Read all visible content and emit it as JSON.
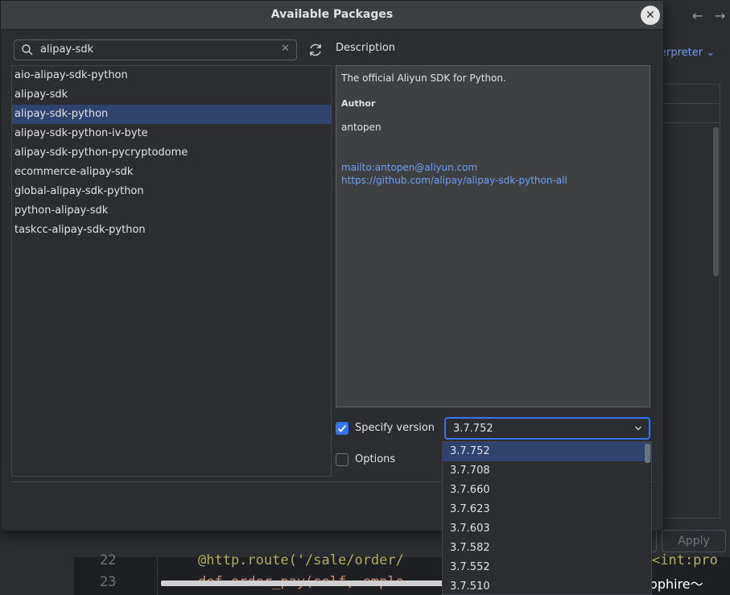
{
  "dialog": {
    "title": "Available Packages",
    "close_glyph": "✕"
  },
  "search": {
    "value": "alipay-sdk",
    "clear_glyph": "✕"
  },
  "packages": [
    {
      "label": "aio-alipay-sdk-python",
      "selected": false
    },
    {
      "label": "alipay-sdk",
      "selected": false
    },
    {
      "label": "alipay-sdk-python",
      "selected": true
    },
    {
      "label": "alipay-sdk-python-iv-byte",
      "selected": false
    },
    {
      "label": "alipay-sdk-python-pycryptodome",
      "selected": false
    },
    {
      "label": "ecommerce-alipay-sdk",
      "selected": false
    },
    {
      "label": "global-alipay-sdk-python",
      "selected": false
    },
    {
      "label": "python-alipay-sdk",
      "selected": false
    },
    {
      "label": "taskcc-alipay-sdk-python",
      "selected": false
    }
  ],
  "description": {
    "label": "Description",
    "summary": "The official Aliyun SDK for Python.",
    "author_heading": "Author",
    "author": "antopen",
    "links": [
      "mailto:antopen@aliyun.com",
      "https://github.com/alipay/alipay-sdk-python-all"
    ]
  },
  "version": {
    "checkbox_label": "Specify version",
    "checked": true,
    "selected": "3.7.752",
    "options": [
      "3.7.752",
      "3.7.708",
      "3.7.660",
      "3.7.623",
      "3.7.603",
      "3.7.582",
      "3.7.552",
      "3.7.510"
    ]
  },
  "options": {
    "checkbox_label": "Options",
    "checked": false
  },
  "background": {
    "interpreter_label": "erpreter ⌄",
    "apply_label": "Apply",
    "line_numbers": [
      "22",
      "23"
    ],
    "code_line_22": "@http.route('/sale/order/",
    "code_line_22_tail": "<int:pro",
    "code_line_23": "def order_pay(self, emplo",
    "watermark": "CSDN @Sapphire～"
  },
  "colors": {
    "accent": "#3574f0",
    "selection": "#2e436e",
    "link": "#6f9ef8"
  }
}
